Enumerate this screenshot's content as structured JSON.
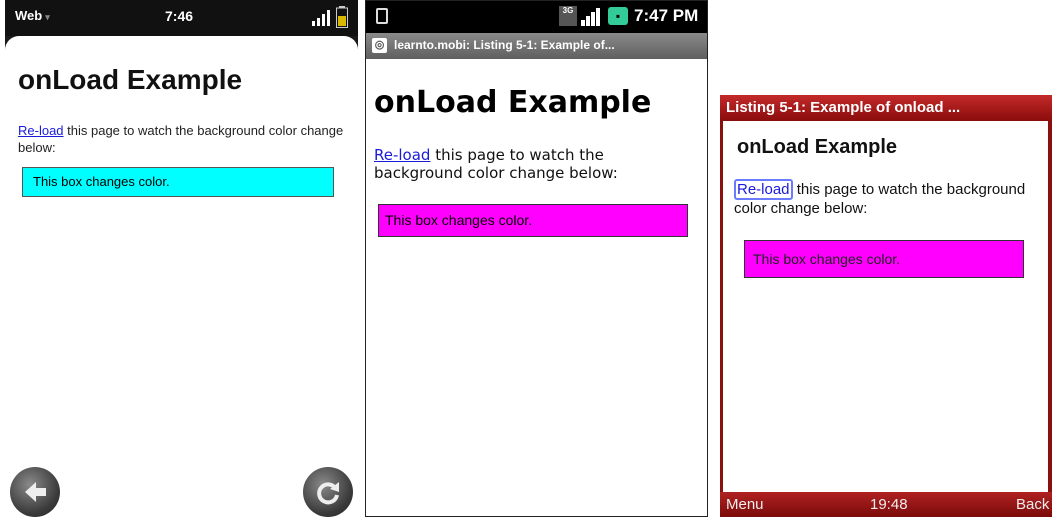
{
  "colors": {
    "box_screen1": "#00ffff",
    "box_screen2": "#ff00ff",
    "box_screen3": "#ff00ff",
    "link": "#1a1adb",
    "symbian_bar": "#a01818"
  },
  "screen1": {
    "status": {
      "carrier": "Web",
      "time": "7:46"
    },
    "heading": "onLoad Example",
    "link_text": "Re-load",
    "paragraph_rest": " this page to watch the background color change below:",
    "box_text": "This box changes color."
  },
  "screen2": {
    "status": {
      "time": "7:47 PM",
      "network": "3G"
    },
    "title": "learnto.mobi: Listing 5-1: Example of...",
    "heading": "onLoad Example",
    "link_text": "Re-load",
    "paragraph_rest": " this page to watch the background color change below:",
    "box_text": "This box changes color."
  },
  "screen3": {
    "title": "Listing 5-1: Example of onload ...",
    "heading": "onLoad Example",
    "link_text": "Re-load",
    "paragraph_rest": " this page to watch the background color change below:",
    "box_text": "This box changes color.",
    "softkeys": {
      "left": "Menu",
      "center": "19:48",
      "right": "Back"
    }
  }
}
